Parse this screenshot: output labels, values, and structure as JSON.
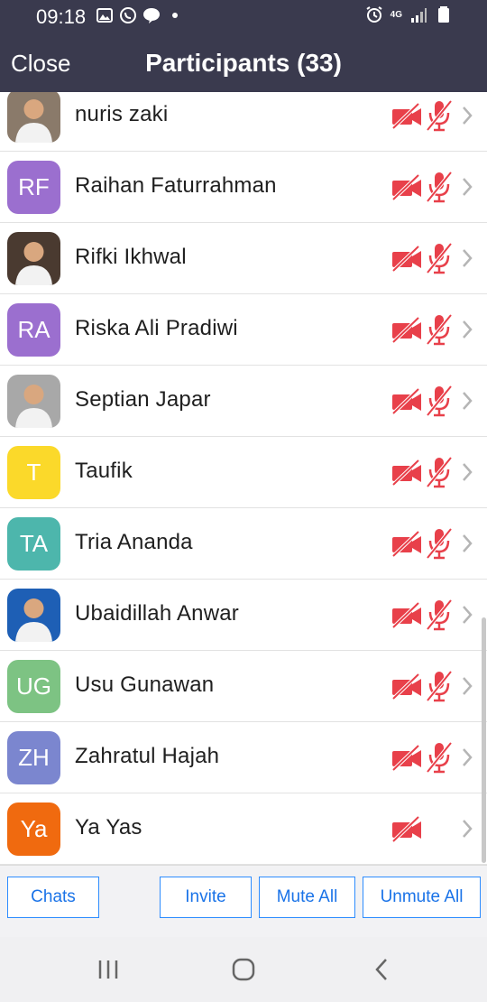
{
  "status_bar": {
    "time": "09:18",
    "network": "4G"
  },
  "header": {
    "close_label": "Close",
    "title": "Participants (33)"
  },
  "participants": [
    {
      "name": "nuris zaki",
      "initials": "",
      "photo": true,
      "color": "#8a7a6a",
      "video_muted": true,
      "audio_muted": true
    },
    {
      "name": "Raihan Faturrahman",
      "initials": "RF",
      "photo": false,
      "color": "#9b6fcf",
      "video_muted": true,
      "audio_muted": true
    },
    {
      "name": "Rifki Ikhwal",
      "initials": "",
      "photo": true,
      "color": "#4a3a30",
      "video_muted": true,
      "audio_muted": true
    },
    {
      "name": "Riska Ali Pradiwi",
      "initials": "RA",
      "photo": false,
      "color": "#9b6fcf",
      "video_muted": true,
      "audio_muted": true
    },
    {
      "name": "Septian Japar",
      "initials": "",
      "photo": true,
      "color": "#a8a8a8",
      "video_muted": true,
      "audio_muted": true
    },
    {
      "name": "Taufik",
      "initials": "T",
      "photo": false,
      "color": "#fbd92a",
      "video_muted": true,
      "audio_muted": true
    },
    {
      "name": "Tria Ananda",
      "initials": "TA",
      "photo": false,
      "color": "#4db6ac",
      "video_muted": true,
      "audio_muted": true
    },
    {
      "name": "Ubaidillah Anwar",
      "initials": "",
      "photo": true,
      "color": "#1e5fb5",
      "video_muted": true,
      "audio_muted": true
    },
    {
      "name": "Usu Gunawan",
      "initials": "UG",
      "photo": false,
      "color": "#7dc383",
      "video_muted": true,
      "audio_muted": true
    },
    {
      "name": "Zahratul Hajah",
      "initials": "ZH",
      "photo": false,
      "color": "#7b86cf",
      "video_muted": true,
      "audio_muted": true
    },
    {
      "name": "Ya Yas",
      "initials": "Ya",
      "photo": false,
      "color": "#f06a0f",
      "video_muted": true,
      "audio_muted": false
    }
  ],
  "toolbar": {
    "chats_label": "Chats",
    "invite_label": "Invite",
    "mute_all_label": "Mute All",
    "unmute_all_label": "Unmute All"
  },
  "colors": {
    "header_bg": "#3a3a4e",
    "muted_red": "#e8404a",
    "button_blue": "#1a73e8"
  },
  "icons": {
    "video": "video-off-icon",
    "mic": "mic-off-icon",
    "chevron": "chevron-right-icon"
  }
}
